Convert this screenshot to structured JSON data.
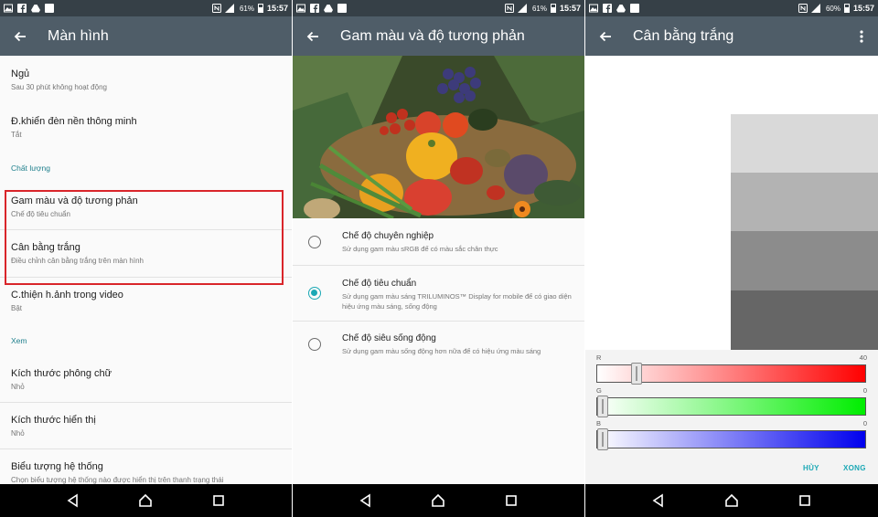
{
  "status_bars": [
    {
      "battery": "61%",
      "time": "15:57"
    },
    {
      "battery": "61%",
      "time": "15:57"
    },
    {
      "battery": "60%",
      "time": "15:57"
    }
  ],
  "screen1": {
    "title": "Màn hình",
    "items": [
      {
        "title": "Ngủ",
        "subtitle": "Sau 30 phút không hoạt động"
      },
      {
        "title": "Đ.khiển đèn nền thông minh",
        "subtitle": "Tắt"
      },
      {
        "category": "Chất lượng"
      },
      {
        "title": "Gam màu và độ tương phản",
        "subtitle": "Chế độ tiêu chuẩn"
      },
      {
        "title": "Cân bằng trắng",
        "subtitle": "Điều chỉnh cân bằng trắng trên màn hình"
      },
      {
        "title": "C.thiện h.ảnh trong video",
        "subtitle": "Bật"
      },
      {
        "category": "Xem"
      },
      {
        "title": "Kích thước phông chữ",
        "subtitle": "Nhỏ"
      },
      {
        "title": "Kích thước hiển thị",
        "subtitle": "Nhỏ"
      },
      {
        "title": "Biểu tượng hệ thống",
        "subtitle": "Chọn biểu tượng hệ thống nào được hiển thị trên thanh trạng thái"
      }
    ]
  },
  "screen2": {
    "title": "Gam màu và độ tương phản",
    "options": [
      {
        "title": "Chế độ chuyên nghiệp",
        "subtitle": "Sử dụng gam màu sRGB để có màu sắc chân thực",
        "selected": false
      },
      {
        "title": "Chế độ tiêu chuẩn",
        "subtitle": "Sử dụng gam màu sáng TRILUMINOS™ Display for mobile để có giao diện hiệu ứng màu sáng, sống động",
        "selected": true
      },
      {
        "title": "Chế độ siêu sống động",
        "subtitle": "Sử dụng gam màu sống động hơn nữa để có hiệu ứng màu sáng",
        "selected": false
      }
    ]
  },
  "screen3": {
    "title": "Cân bằng trắng",
    "sliders": [
      {
        "label": "R",
        "value": "40",
        "level": 0.13
      },
      {
        "label": "G",
        "value": "0",
        "level": 0.0
      },
      {
        "label": "B",
        "value": "0",
        "level": 0.0
      }
    ],
    "cancel_label": "HỦY",
    "done_label": "XONG"
  },
  "colors": {
    "appbar": "#4f5d68",
    "statusbar": "#364047",
    "accent": "#1ba8b5",
    "category": "#1e7f8c",
    "highlight": "#d9252a"
  },
  "icons": [
    "back-arrow-icon",
    "more-vert-icon",
    "nav-back-icon",
    "nav-home-icon",
    "nav-recents-icon",
    "nfc-icon",
    "signal-icon",
    "battery-icon"
  ]
}
